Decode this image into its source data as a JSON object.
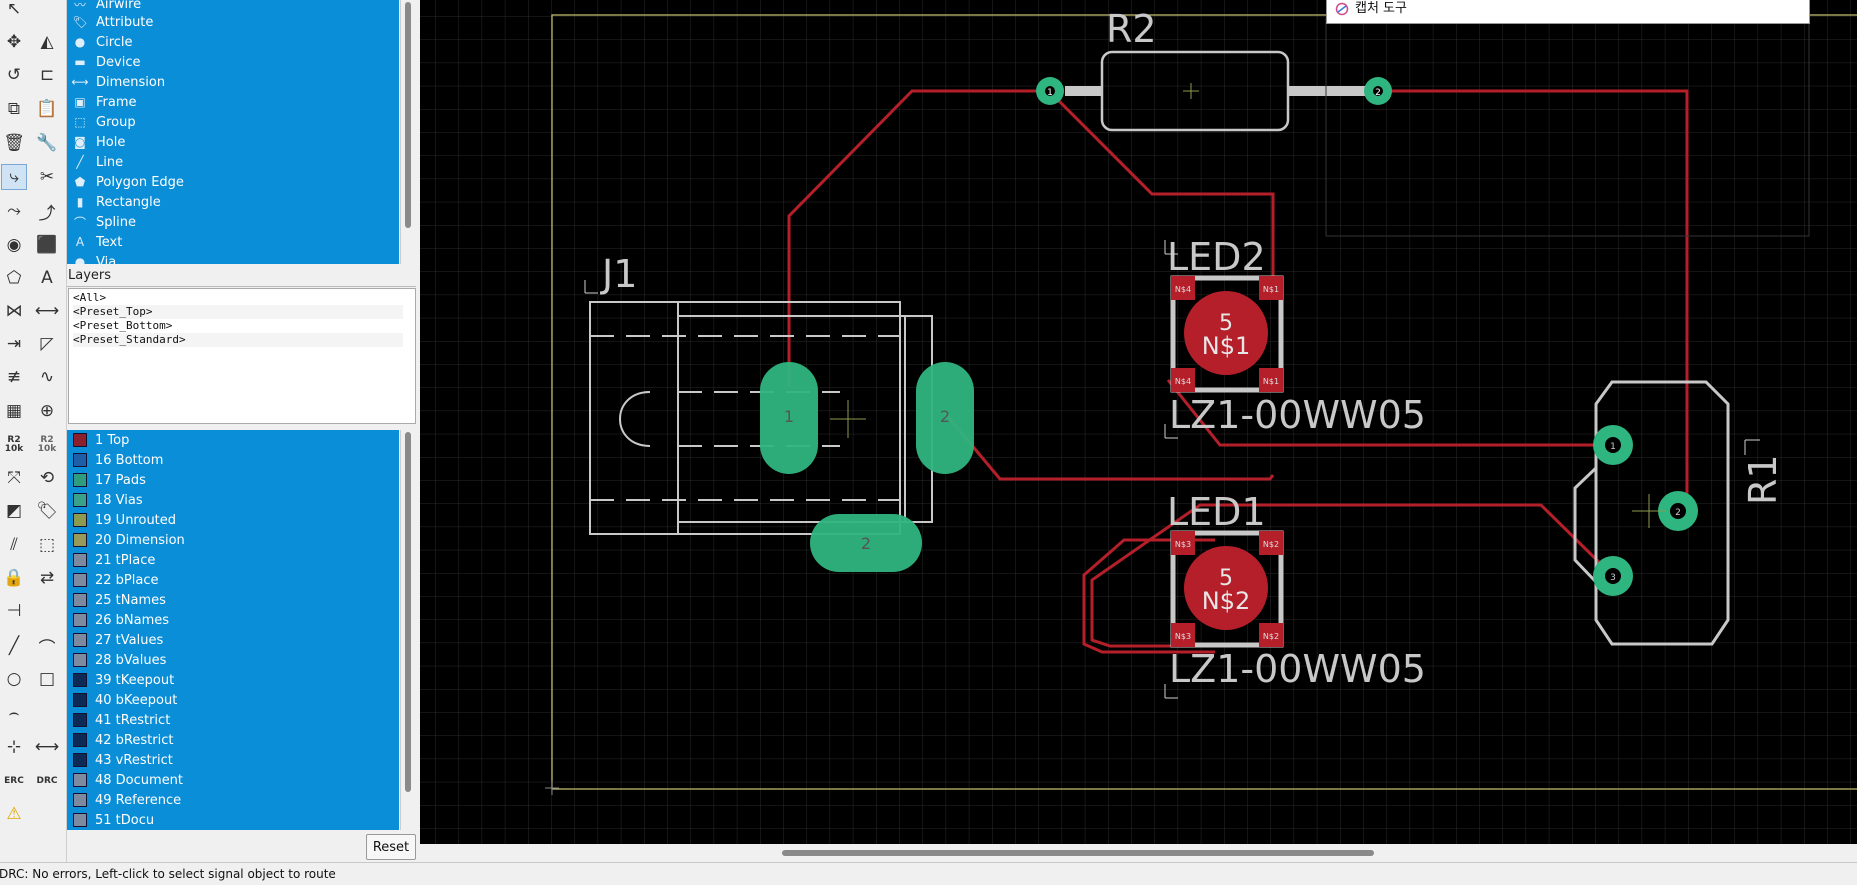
{
  "object_list": {
    "items": [
      {
        "label": "Airwire",
        "icon": "airwire-icon"
      },
      {
        "label": "Attribute",
        "icon": "tag-icon"
      },
      {
        "label": "Circle",
        "icon": "circle-icon"
      },
      {
        "label": "Device",
        "icon": "device-icon"
      },
      {
        "label": "Dimension",
        "icon": "dimension-icon"
      },
      {
        "label": "Frame",
        "icon": "frame-icon"
      },
      {
        "label": "Group",
        "icon": "group-icon"
      },
      {
        "label": "Hole",
        "icon": "hole-icon"
      },
      {
        "label": "Line",
        "icon": "line-icon"
      },
      {
        "label": "Polygon Edge",
        "icon": "polygon-icon"
      },
      {
        "label": "Rectangle",
        "icon": "rectangle-icon"
      },
      {
        "label": "Spline",
        "icon": "spline-icon"
      },
      {
        "label": "Text",
        "icon": "text-icon"
      },
      {
        "label": "Via",
        "icon": "via-icon"
      }
    ]
  },
  "layers_panel": {
    "title": "Layers",
    "presets": [
      "<All>",
      "<Preset_Top>",
      "<Preset_Bottom>",
      "<Preset_Standard>"
    ],
    "layers": [
      {
        "label": "1 Top",
        "color": "#8c1f2c"
      },
      {
        "label": "16 Bottom",
        "color": "#1f5fa8"
      },
      {
        "label": "17 Pads",
        "color": "#2f9c80"
      },
      {
        "label": "18 Vias",
        "color": "#3aa18a"
      },
      {
        "label": "19 Unrouted",
        "color": "#8e9a4e"
      },
      {
        "label": "20 Dimension",
        "color": "#9a9a58"
      },
      {
        "label": "21 tPlace",
        "color": "#7d8aa0"
      },
      {
        "label": "22 bPlace",
        "color": "#7d8aa0"
      },
      {
        "label": "25 tNames",
        "color": "#7d8aa0"
      },
      {
        "label": "26 bNames",
        "color": "#7d8aa0"
      },
      {
        "label": "27 tValues",
        "color": "#7d8aa0"
      },
      {
        "label": "28 bValues",
        "color": "#7d8aa0"
      },
      {
        "label": "39 tKeepout",
        "color": "#0d2b55"
      },
      {
        "label": "40 bKeepout",
        "color": "#0d2b55"
      },
      {
        "label": "41 tRestrict",
        "color": "#0d2b55"
      },
      {
        "label": "42 bRestrict",
        "color": "#0d2b55"
      },
      {
        "label": "43 vRestrict",
        "color": "#0d2b55"
      },
      {
        "label": "48 Document",
        "color": "#7d8aa0"
      },
      {
        "label": "49 Reference",
        "color": "#7d8aa0"
      },
      {
        "label": "51 tDocu",
        "color": "#7d8aa0"
      }
    ],
    "reset_label": "Reset"
  },
  "toolbar": {
    "r2_label": "R2",
    "r2_sub": "10k",
    "r2_value": "10k",
    "erc_label": "ERC",
    "drc_label": "DRC"
  },
  "capture_popup": {
    "label": "캡처 도구"
  },
  "board": {
    "r2_name": "R2",
    "j1_name": "J1",
    "led2_name": "LED2",
    "led1_name": "LED1",
    "r1_name": "R1",
    "led2_value": "LZ1-00WW05",
    "led1_value": "LZ1-00WW05",
    "led2_pad_num": "5",
    "led2_pad_name": "N$1",
    "led1_pad_num": "5",
    "led1_pad_name": "N$2",
    "j1_pad1": "1",
    "j1_pad2": "2",
    "j1_pad3": "2",
    "led2_pins": [
      "N$4",
      "N$1",
      "N$4",
      "N$1"
    ],
    "led1_pins": [
      "N$3",
      "N$2",
      "N$3",
      "N$2"
    ],
    "r1_pins": [
      "1",
      "2",
      "3"
    ],
    "r2_pins": [
      "1",
      "2"
    ],
    "colors": {
      "background": "#000000",
      "grid": "#2a2a2a",
      "track": "#b51f2a",
      "pad": "#2fb57f",
      "silk": "#c8c8c8",
      "dimension": "#bdb86a"
    }
  },
  "status": {
    "text": "DRC: No errors, Left-click to select signal object to route"
  }
}
